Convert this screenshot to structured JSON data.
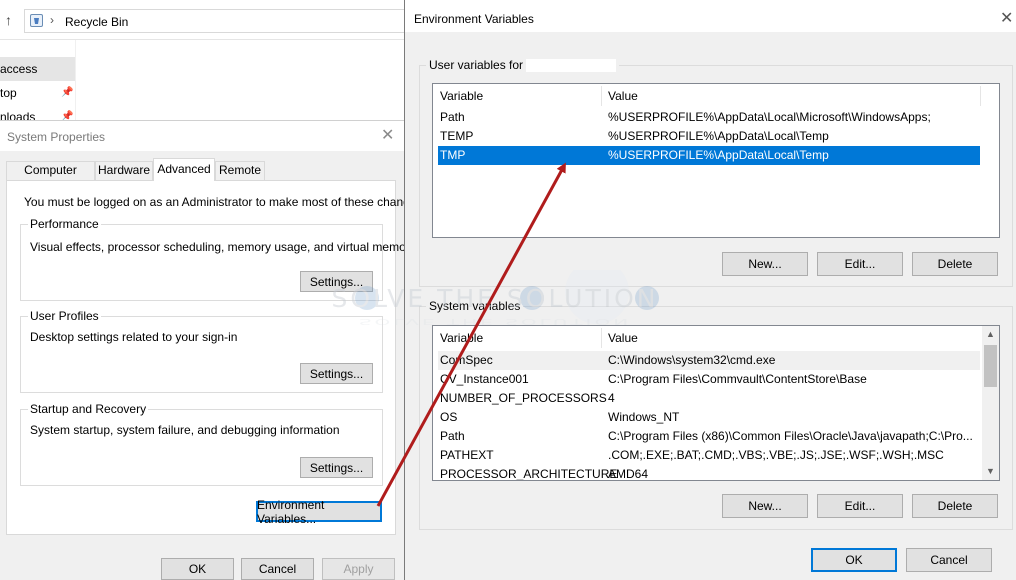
{
  "explorer": {
    "address": "Recycle Bin",
    "nav": [
      "access",
      "top",
      "nloads"
    ]
  },
  "system_properties": {
    "title": "System Properties",
    "tabs": [
      "Computer Name",
      "Hardware",
      "Advanced",
      "Remote"
    ],
    "active_tab": "Advanced",
    "admin_note": "You must be logged on as an Administrator to make most of these changes.",
    "performance": {
      "label": "Performance",
      "text": "Visual effects, processor scheduling, memory usage, and virtual memory",
      "button": "Settings..."
    },
    "user_profiles": {
      "label": "User Profiles",
      "text": "Desktop settings related to your sign-in",
      "button": "Settings..."
    },
    "startup_recovery": {
      "label": "Startup and Recovery",
      "text": "System startup, system failure, and debugging information",
      "button": "Settings..."
    },
    "env_button": "Environment Variables...",
    "ok": "OK",
    "cancel": "Cancel",
    "apply": "Apply"
  },
  "environment_variables": {
    "title": "Environment Variables",
    "user_group_label": "User variables for",
    "user_columns": [
      "Variable",
      "Value"
    ],
    "user_rows": [
      {
        "variable": "Path",
        "value": "%USERPROFILE%\\AppData\\Local\\Microsoft\\WindowsApps;"
      },
      {
        "variable": "TEMP",
        "value": "%USERPROFILE%\\AppData\\Local\\Temp"
      },
      {
        "variable": "TMP",
        "value": "%USERPROFILE%\\AppData\\Local\\Temp"
      }
    ],
    "user_selected_row": 2,
    "user_buttons": {
      "new": "New...",
      "edit": "Edit...",
      "delete": "Delete"
    },
    "system_group_label": "System variables",
    "system_columns": [
      "Variable",
      "Value"
    ],
    "system_rows": [
      {
        "variable": "ComSpec",
        "value": "C:\\Windows\\system32\\cmd.exe"
      },
      {
        "variable": "CV_Instance001",
        "value": "C:\\Program Files\\Commvault\\ContentStore\\Base"
      },
      {
        "variable": "NUMBER_OF_PROCESSORS",
        "value": "4"
      },
      {
        "variable": "OS",
        "value": "Windows_NT"
      },
      {
        "variable": "Path",
        "value": "C:\\Program Files (x86)\\Common Files\\Oracle\\Java\\javapath;C:\\Pro..."
      },
      {
        "variable": "PATHEXT",
        "value": ".COM;.EXE;.BAT;.CMD;.VBS;.VBE;.JS;.JSE;.WSF;.WSH;.MSC"
      },
      {
        "variable": "PROCESSOR_ARCHITECTURE",
        "value": "AMD64"
      }
    ],
    "system_buttons": {
      "new": "New...",
      "edit": "Edit...",
      "delete": "Delete"
    },
    "ok": "OK",
    "cancel": "Cancel"
  },
  "watermark": {
    "line1": "SOLVE THE SOLUTION",
    "line2": "SOLVE THE SOLUTION"
  },
  "colors": {
    "selection": "#0078d7",
    "annotation_arrow": "#b01c1c",
    "default_button_border": "#0078d7"
  }
}
